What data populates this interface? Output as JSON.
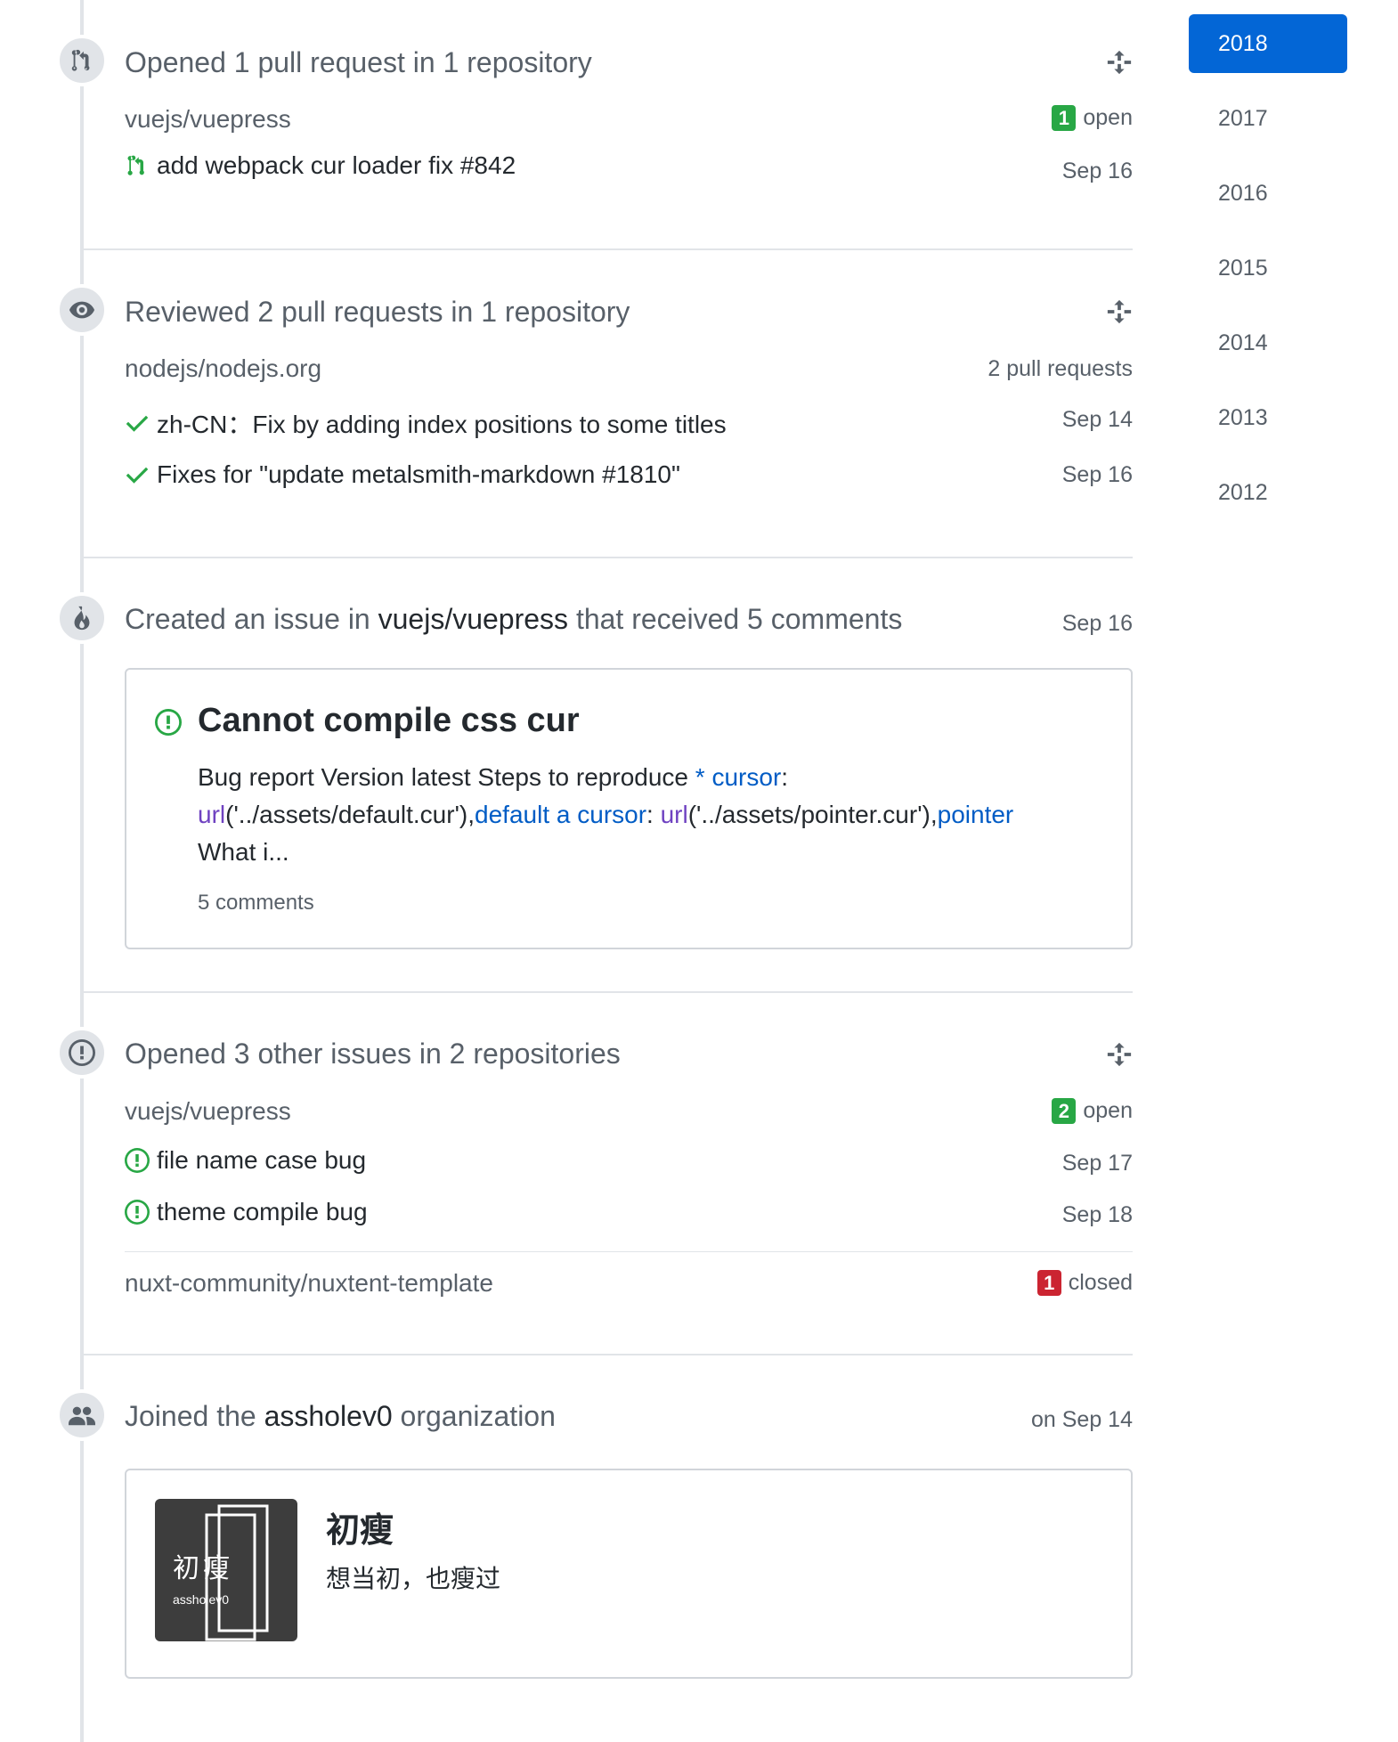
{
  "sections": {
    "opened_prs": {
      "title_prefix": "Opened 1 pull request in 1 repository",
      "repo": "vuejs/vuepress",
      "badge_count": "1",
      "badge_label": "open",
      "items": [
        {
          "text": "add webpack cur loader fix #842",
          "date": "Sep 16"
        }
      ]
    },
    "reviewed_prs": {
      "title": "Reviewed 2 pull requests in 1 repository",
      "repo": "nodejs/nodejs.org",
      "count_label": "2 pull requests",
      "items": [
        {
          "text": "zh-CN：Fix by adding index positions to some titles",
          "date": "Sep 14"
        },
        {
          "text": "Fixes for \"update metalsmith-markdown #1810\"",
          "date": "Sep 16"
        }
      ]
    },
    "created_issue": {
      "title_pre": "Created an issue in ",
      "title_repo": "vuejs/vuepress",
      "title_post": " that received 5 comments",
      "date": "Sep 16",
      "issue_title": "Cannot compile css cur",
      "body": {
        "t1": "Bug report Version latest Steps to reproduce ",
        "t2": "* ",
        "t3": "cursor",
        "t4": ":",
        "t5": "url",
        "t6": "('../assets/default.cur'),",
        "t7": "default",
        "t8": " ",
        "t9": "a",
        "t10": " ",
        "t11": "cursor",
        "t12": ": ",
        "t13": "url",
        "t14": "('../assets/pointer.cur'),",
        "t15": "pointer",
        "t16": "What i..."
      },
      "comments": "5 comments"
    },
    "opened_issues": {
      "title": "Opened 3 other issues in 2 repositories",
      "repo1": "vuejs/vuepress",
      "repo1_badge_count": "2",
      "repo1_badge_label": "open",
      "items": [
        {
          "text": "file name case bug",
          "date": "Sep 17"
        },
        {
          "text": "theme compile bug",
          "date": "Sep 18"
        }
      ],
      "repo2": "nuxt-community/nuxtent-template",
      "repo2_badge_count": "1",
      "repo2_badge_label": "closed"
    },
    "joined_org": {
      "title_pre": "Joined the ",
      "title_org": "assholev0",
      "title_post": " organization",
      "date": "on Sep 14",
      "org_display_name": "初瘦",
      "org_description": "想当初，也瘦过",
      "avatar_char1": "初",
      "avatar_char2": "瘦",
      "avatar_handle": "assholev0"
    }
  },
  "year_nav": [
    "2018",
    "2017",
    "2016",
    "2015",
    "2014",
    "2013",
    "2012"
  ],
  "selected_year": "2018",
  "colors": {
    "accent": "#0366d6",
    "green": "#28a745",
    "red": "#cb2431",
    "muted": "#586069"
  }
}
